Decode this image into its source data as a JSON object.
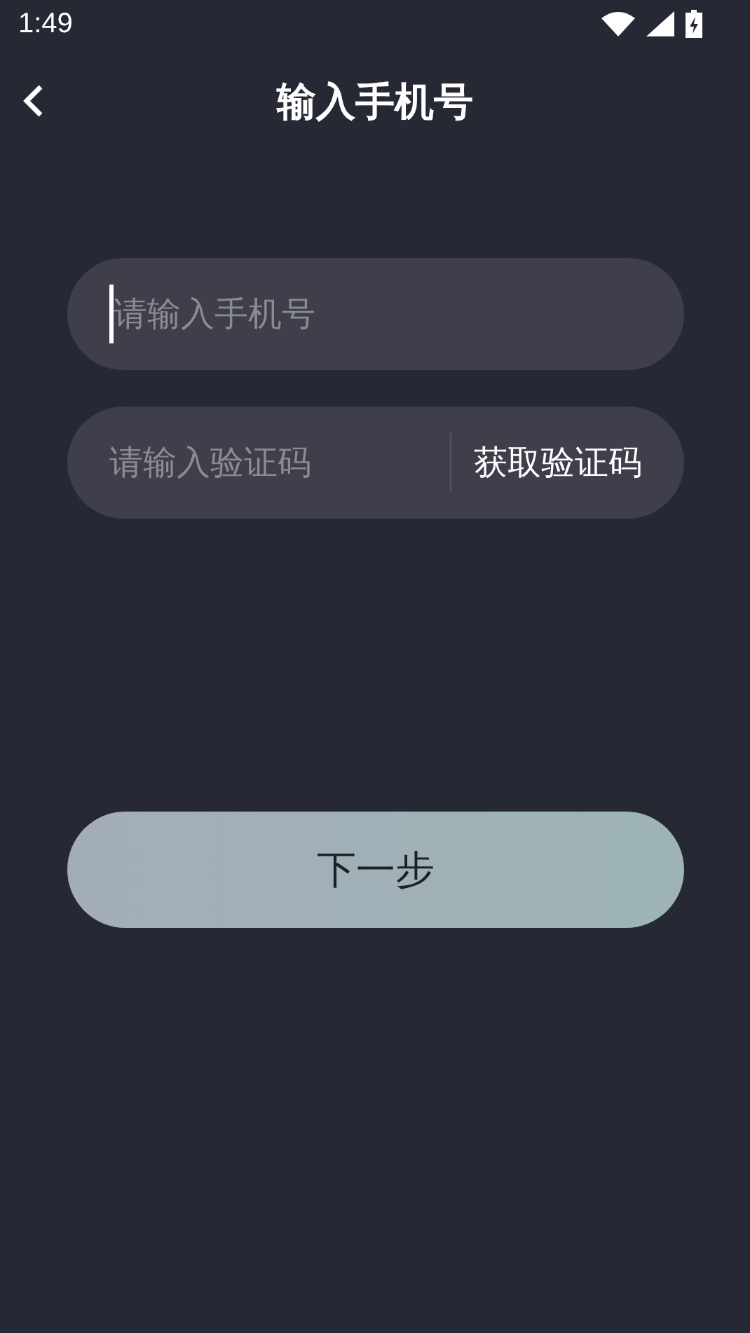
{
  "status_bar": {
    "time": "1:49"
  },
  "header": {
    "title": "输入手机号"
  },
  "phone_field": {
    "placeholder": "请输入手机号",
    "focused": true
  },
  "code_field": {
    "placeholder": "请输入验证码",
    "button": "获取验证码"
  },
  "next_button": {
    "label": "下一步"
  }
}
